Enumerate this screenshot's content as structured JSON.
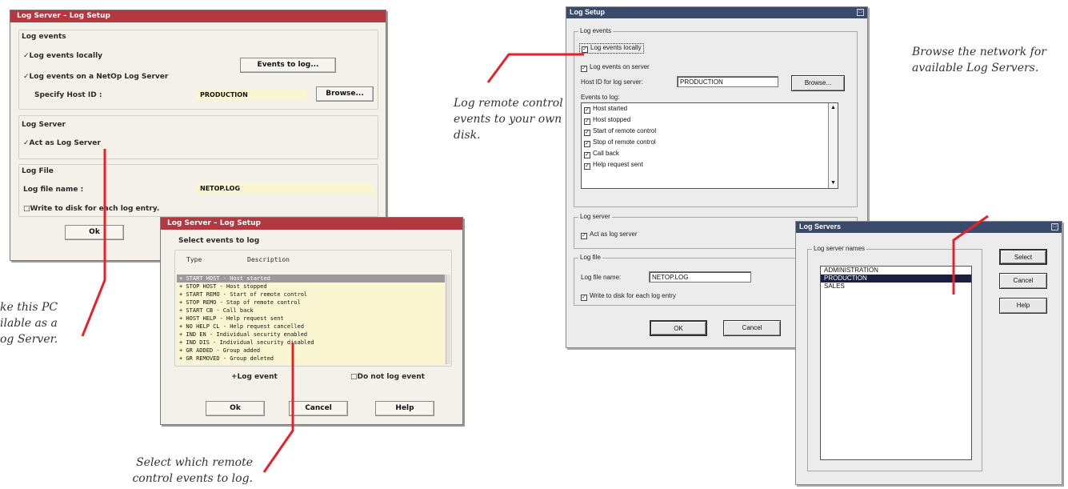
{
  "colors": {
    "callout_line": "#e8202a",
    "os2_title": "#b3383f",
    "win_title": "#3a4a6a",
    "field_fill": "#fbf6d2"
  },
  "d1": {
    "title": "Log Server – Log Setup",
    "log_events_group": "Log events",
    "log_locally": "Log events locally",
    "log_on_server": "Log events on a NetOp Log Server",
    "events_to_log_button": "Events to log...",
    "specify_host_label": "Specify Host ID :",
    "host_id_value": "PRODUCTION",
    "browse_button": "Browse...",
    "log_server_group": "Log Server",
    "act_as_log_server": "Act as Log Server",
    "log_file_group": "Log File",
    "log_file_name_label": "Log file name :",
    "log_file_name_value": "NETOP.LOG",
    "write_to_disk": "Write to disk for each log entry.",
    "ok_button": "Ok"
  },
  "d2": {
    "title": "Log Server – Log Setup",
    "heading": "Select events to log",
    "col_type": "Type",
    "col_description": "Description",
    "events": [
      "+ START HOST - Host started",
      "+ STOP HOST  - Host stopped",
      "+ START REMO - Start of remote control",
      "+ STOP REMO  - Stop of remote control",
      "+ START CB   - Call back",
      "+ HOST HELP  - Help request sent",
      "+ NO HELP CL - Help request cancelled",
      "+ IND EN     - Individual security enabled",
      "+ IND DIS    - Individual security disabled",
      "+ GR ADDED   - Group added",
      "+ GR REMOVED - Group deleted"
    ],
    "log_event_option": "+Log event",
    "do_not_log_option": "Do not log event",
    "ok_button": "Ok",
    "cancel_button": "Cancel",
    "help_button": "Help"
  },
  "d3": {
    "title": "Log Setup",
    "log_events_group": "Log events",
    "log_locally": "Log events locally",
    "log_on_server": "Log events on server",
    "host_id_label": "Host ID for log server:",
    "host_id_value": "PRODUCTION",
    "browse_button": "Browse...",
    "events_to_log_label": "Events to log:",
    "events": [
      "Host started",
      "Host stopped",
      "Start of remote control",
      "Stop of remote control",
      "Call back",
      "Help request sent"
    ],
    "log_server_group": "Log server",
    "act_as_log_server": "Act as log server",
    "log_file_group": "Log file",
    "log_file_name_label": "Log file name:",
    "log_file_name_value": "NETOP.LOG",
    "write_to_disk": "Write to disk for each log entry",
    "ok_button": "OK",
    "cancel_button": "Cancel"
  },
  "d4": {
    "title": "Log Servers",
    "group": "Log server names",
    "servers": [
      "ADMINISTRATION",
      "PRODUCTION",
      "SALES"
    ],
    "select_button": "Select",
    "cancel_button": "Cancel",
    "help_button": "Help"
  },
  "callouts": {
    "make_pc": [
      "ke this PC",
      "ilable as a",
      "og Server."
    ],
    "select_events": [
      "Select which remote",
      "control events to log."
    ],
    "log_remote": [
      "Log remote control",
      "events to your own",
      "disk."
    ],
    "browse_network": [
      "Browse the network for",
      "available Log Servers."
    ]
  }
}
